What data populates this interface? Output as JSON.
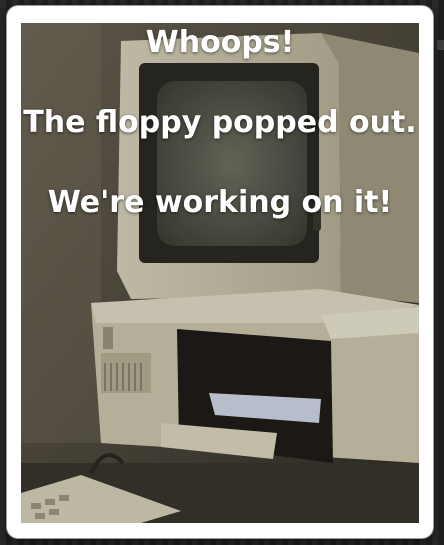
{
  "message": {
    "line1": "Whoops!",
    "line2": "The floppy popped out.",
    "line3": "We're working on it!"
  },
  "image": {
    "subject": "vintage-computer-with-floppy-drive"
  },
  "colors": {
    "dialog_background": "#ffffff",
    "text": "#ffffff",
    "backdrop": "#1f1f1f"
  }
}
